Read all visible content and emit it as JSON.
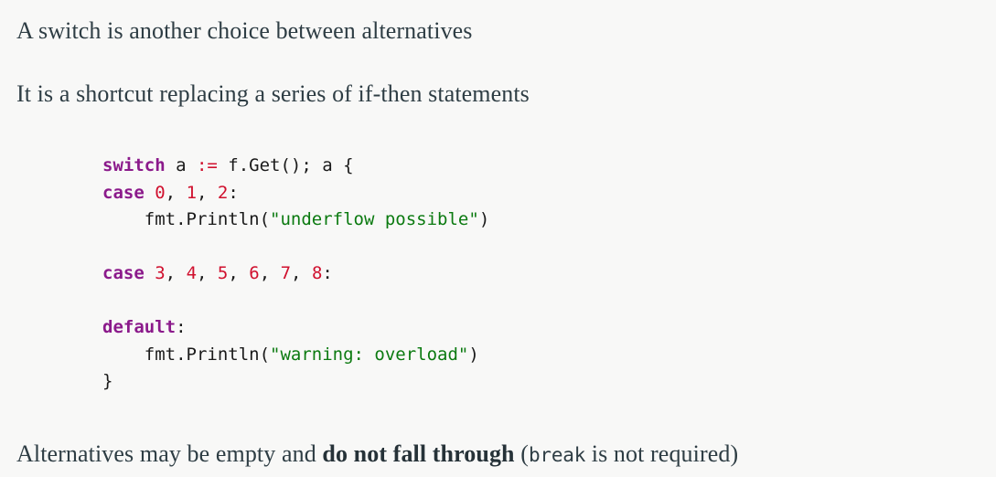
{
  "theme": {
    "background": "#f8f8f7",
    "text_color": "#2e3d44",
    "keyword_color": "#8b1a8b",
    "number_color": "#d0102e",
    "string_color": "#0b7a10",
    "plain_code_color": "#1a1a1a"
  },
  "slide": {
    "paragraph_1": "A switch is another choice between alternatives",
    "paragraph_2": "It is a shortcut replacing a series of if-then statements",
    "closing": {
      "part_1": "Alternatives may be empty and ",
      "emphasis": "do not fall through",
      "part_2": " (",
      "code": "break",
      "part_3": " is not required)"
    }
  },
  "code_block": {
    "language": "go",
    "plain_text": "switch a := f.Get(); a {\ncase 0, 1, 2:\n    fmt.Println(\"underflow possible\")\n\ncase 3, 4, 5, 6, 7, 8:\n\ndefault:\n    fmt.Println(\"warning: overload\")\n}",
    "lines": [
      {
        "id": "line-1",
        "tokens": [
          {
            "t": "switch",
            "k": "kw"
          },
          {
            "t": " a ",
            "k": "pln"
          },
          {
            "t": ":=",
            "k": "op"
          },
          {
            "t": " f.Get(); a {",
            "k": "pln"
          }
        ]
      },
      {
        "id": "line-2",
        "tokens": [
          {
            "t": "case",
            "k": "kw"
          },
          {
            "t": " ",
            "k": "pln"
          },
          {
            "t": "0",
            "k": "num"
          },
          {
            "t": ", ",
            "k": "pln"
          },
          {
            "t": "1",
            "k": "num"
          },
          {
            "t": ", ",
            "k": "pln"
          },
          {
            "t": "2",
            "k": "num"
          },
          {
            "t": ":",
            "k": "pln"
          }
        ]
      },
      {
        "id": "line-3",
        "tokens": [
          {
            "t": "    fmt.Println(",
            "k": "pln"
          },
          {
            "t": "\"underflow possible\"",
            "k": "str"
          },
          {
            "t": ")",
            "k": "pln"
          }
        ]
      },
      {
        "id": "line-4",
        "tokens": []
      },
      {
        "id": "line-5",
        "tokens": [
          {
            "t": "case",
            "k": "kw"
          },
          {
            "t": " ",
            "k": "pln"
          },
          {
            "t": "3",
            "k": "num"
          },
          {
            "t": ", ",
            "k": "pln"
          },
          {
            "t": "4",
            "k": "num"
          },
          {
            "t": ", ",
            "k": "pln"
          },
          {
            "t": "5",
            "k": "num"
          },
          {
            "t": ", ",
            "k": "pln"
          },
          {
            "t": "6",
            "k": "num"
          },
          {
            "t": ", ",
            "k": "pln"
          },
          {
            "t": "7",
            "k": "num"
          },
          {
            "t": ", ",
            "k": "pln"
          },
          {
            "t": "8",
            "k": "num"
          },
          {
            "t": ":",
            "k": "pln"
          }
        ]
      },
      {
        "id": "line-6",
        "tokens": []
      },
      {
        "id": "line-7",
        "tokens": [
          {
            "t": "default",
            "k": "kw"
          },
          {
            "t": ":",
            "k": "pln"
          }
        ]
      },
      {
        "id": "line-8",
        "tokens": [
          {
            "t": "    fmt.Println(",
            "k": "pln"
          },
          {
            "t": "\"warning: overload\"",
            "k": "str"
          },
          {
            "t": ")",
            "k": "pln"
          }
        ]
      },
      {
        "id": "line-9",
        "tokens": [
          {
            "t": "}",
            "k": "pln"
          }
        ]
      }
    ]
  }
}
